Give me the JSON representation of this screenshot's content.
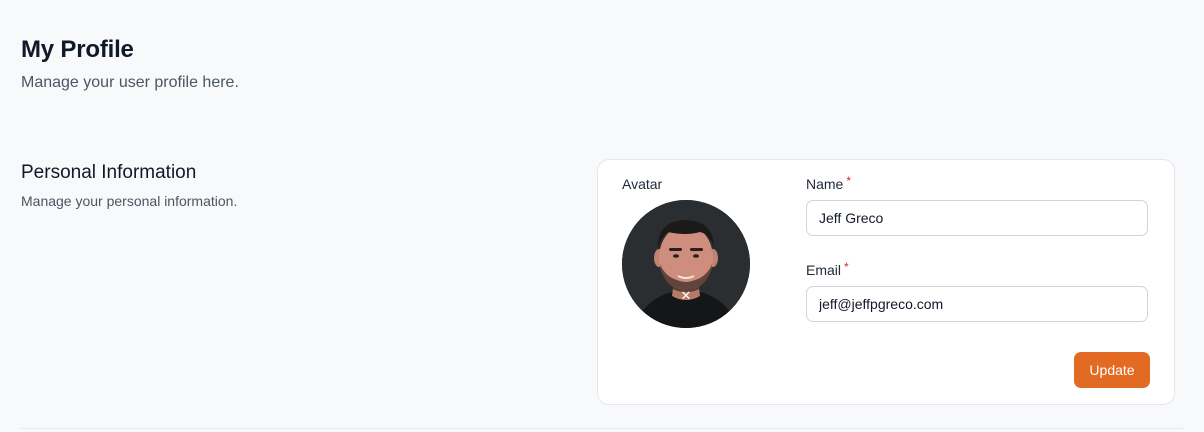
{
  "header": {
    "title": "My Profile",
    "subtitle": "Manage your user profile here."
  },
  "personal_info": {
    "title": "Personal Information",
    "description": "Manage your personal information."
  },
  "form": {
    "avatar_label": "Avatar",
    "avatar_remove_glyph": "✕",
    "name_label": "Name",
    "name_value": "Jeff Greco",
    "email_label": "Email",
    "email_value": "jeff@jeffpgreco.com",
    "required_marker": "*",
    "update_label": "Update"
  },
  "colors": {
    "accent": "#e36a22",
    "required": "#dc2626",
    "background": "#f8f9fb"
  }
}
